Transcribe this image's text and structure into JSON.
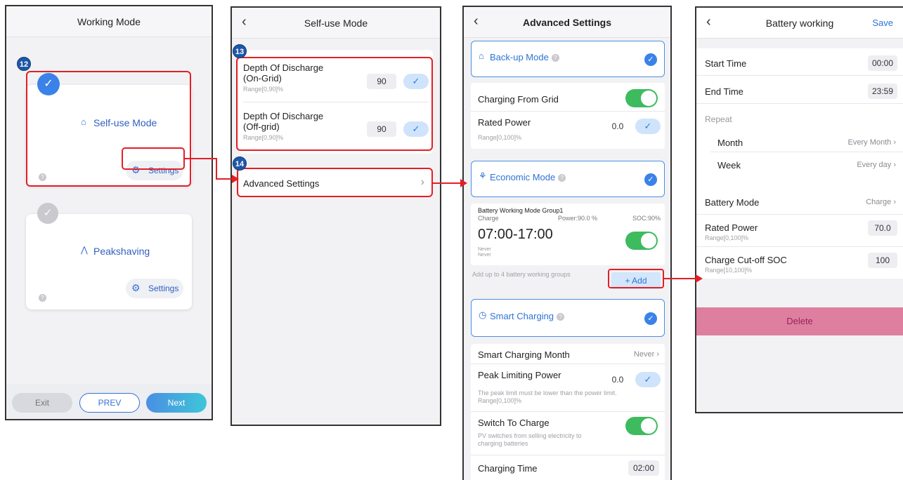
{
  "screen1": {
    "title": "Working Mode",
    "step_badge": "12",
    "mode1": {
      "label": "Self-use Mode",
      "settings_label": "Settings",
      "selected": true
    },
    "mode2": {
      "label": "Peakshaving",
      "settings_label": "Settings",
      "selected": false
    },
    "footer": {
      "exit_label": "Exit",
      "prev_label": "PREV",
      "next_label": "Next"
    }
  },
  "screen2": {
    "title": "Self-use Mode",
    "step_badge_13": "13",
    "step_badge_14": "14",
    "dod_on": {
      "label_line1": "Depth Of Discharge",
      "label_line2": "(On-Grid)",
      "range": "Range[0,90]%",
      "value": "90"
    },
    "dod_off": {
      "label_line1": "Depth Of Discharge",
      "label_line2": "(Off-grid)",
      "range": "Range[0,90]%",
      "value": "90"
    },
    "advanced_label": "Advanced Settings"
  },
  "screen3": {
    "title": "Advanced Settings",
    "backup": {
      "label": "Back-up Mode",
      "charging_from_grid": "Charging From Grid",
      "rated_power": "Rated Power",
      "rated_power_value": "0.0",
      "rated_power_range": "Range[0,100]%"
    },
    "economic": {
      "label": "Economic Mode",
      "group_title": "Battery Working Mode Group1",
      "charge_label": "Charge",
      "power_label": "Power:90.0 %",
      "soc_label": "SOC:90%",
      "time_range": "07:00-17:00",
      "never1": "Never",
      "never2": "Never",
      "add_hint": "Add up to 4 battery working groups",
      "add_label": "+ Add"
    },
    "smart": {
      "label": "Smart Charging",
      "month_label": "Smart Charging Month",
      "month_value": "Never",
      "peak_label": "Peak Limiting Power",
      "peak_value": "0.0",
      "peak_note1": "The peak limit must be lower than the power limit.",
      "peak_note2": "Range[0,100]%",
      "switch_label": "Switch To Charge",
      "switch_note1": "PV switches from selling electricity to",
      "switch_note2": "charging batteries",
      "charging_time_label": "Charging Time",
      "charging_time_value": "02:00"
    }
  },
  "screen4": {
    "title": "Battery working",
    "save_label": "Save",
    "start_time_label": "Start Time",
    "start_time_value": "00:00",
    "end_time_label": "End Time",
    "end_time_value": "23:59",
    "repeat_label": "Repeat",
    "month_label": "Month",
    "month_value": "Every Month",
    "week_label": "Week",
    "week_value": "Every day",
    "battery_mode_label": "Battery Mode",
    "battery_mode_value": "Charge",
    "rated_power_label": "Rated Power",
    "rated_power_range": "Range[0,100]%",
    "rated_power_value": "70.0",
    "cutoff_label": "Charge Cut-off SOC",
    "cutoff_range": "Range[10,100]%",
    "cutoff_value": "100",
    "delete_label": "Delete"
  },
  "colors": {
    "accent_blue": "#3b82e8",
    "highlight_red": "#e21f26",
    "toggle_green": "#3dbb5e",
    "next_button": "#3ec6d8",
    "delete_pink": "#de7fa0"
  },
  "icons": [
    "house-icon",
    "gear-icon",
    "peak-icon",
    "chevron-left-icon",
    "chevron-right-icon",
    "check-icon",
    "help-icon",
    "backup-icon",
    "economic-icon",
    "clock-icon"
  ]
}
